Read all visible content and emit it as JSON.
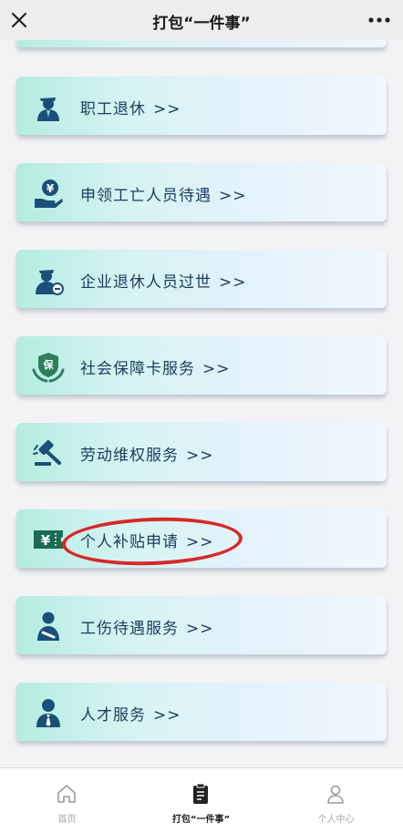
{
  "header": {
    "title": "打包“一件事”"
  },
  "services": [
    {
      "label": "职工退休",
      "arrow": ">>",
      "icon": "retiree-icon"
    },
    {
      "label": "申领工亡人员待遇",
      "arrow": ">>",
      "icon": "yuan-hand-icon"
    },
    {
      "label": "企业退休人员过世",
      "arrow": ">>",
      "icon": "deceased-retiree-icon"
    },
    {
      "label": "社会保障卡服务",
      "arrow": ">>",
      "icon": "security-card-icon"
    },
    {
      "label": "劳动维权服务",
      "arrow": ">>",
      "icon": "gavel-icon"
    },
    {
      "label": "个人补贴申请",
      "arrow": ">>",
      "icon": "subsidy-ticket-icon"
    },
    {
      "label": "工伤待遇服务",
      "arrow": ">>",
      "icon": "injured-worker-icon"
    },
    {
      "label": "人才服务",
      "arrow": ">>",
      "icon": "talent-icon"
    }
  ],
  "tabs": [
    {
      "label": "首页",
      "icon": "home-icon"
    },
    {
      "label": "打包“一件事”",
      "icon": "clipboard-icon"
    },
    {
      "label": "个人中心",
      "icon": "user-icon"
    }
  ],
  "colors": {
    "accent": "#1a4f7a",
    "highlight_circle": "#d62828",
    "card_start": "#b4ecdf",
    "card_end": "#f0f7fd"
  }
}
